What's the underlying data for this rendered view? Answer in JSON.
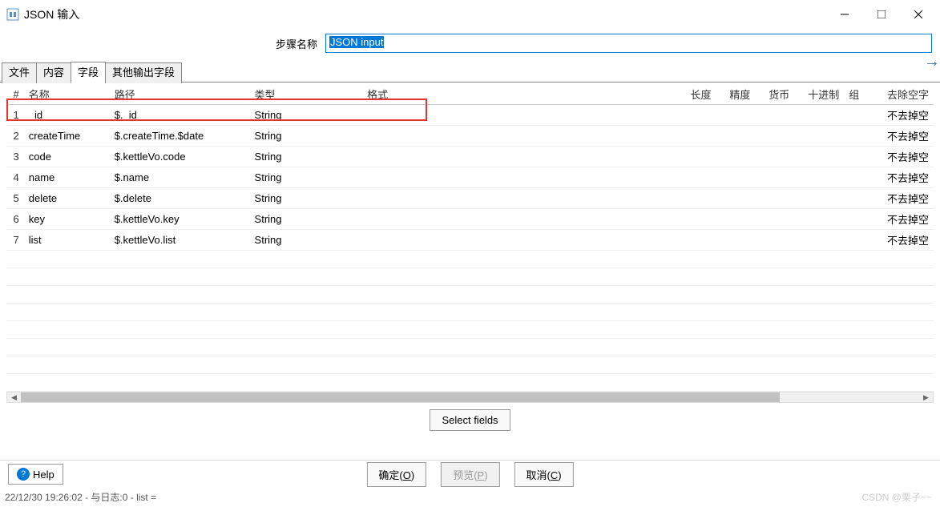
{
  "window": {
    "title": "JSON 输入"
  },
  "step": {
    "label": "步骤名称",
    "value": "JSON input"
  },
  "tabs": {
    "t0": "文件",
    "t1": "内容",
    "t2": "字段",
    "t3": "其他输出字段"
  },
  "columns": {
    "idx": "#",
    "name": "名称",
    "path": "路径",
    "type": "类型",
    "format": "格式",
    "length": "长度",
    "precision": "精度",
    "currency": "货币",
    "decimal": "十进制",
    "group": "组",
    "trim": "去除空字"
  },
  "rows": [
    {
      "idx": "1",
      "name": "_id",
      "path": "$._id",
      "type": "String",
      "format": "",
      "length": "",
      "precision": "",
      "currency": "",
      "decimal": "",
      "group": "",
      "trim": "不去掉空"
    },
    {
      "idx": "2",
      "name": "createTime",
      "path": "$.createTime.$date",
      "type": "String",
      "format": "",
      "length": "",
      "precision": "",
      "currency": "",
      "decimal": "",
      "group": "",
      "trim": "不去掉空"
    },
    {
      "idx": "3",
      "name": "code",
      "path": "$.kettleVo.code",
      "type": "String",
      "format": "",
      "length": "",
      "precision": "",
      "currency": "",
      "decimal": "",
      "group": "",
      "trim": "不去掉空"
    },
    {
      "idx": "4",
      "name": "name",
      "path": "$.name",
      "type": "String",
      "format": "",
      "length": "",
      "precision": "",
      "currency": "",
      "decimal": "",
      "group": "",
      "trim": "不去掉空"
    },
    {
      "idx": "5",
      "name": "delete",
      "path": "$.delete",
      "type": "String",
      "format": "",
      "length": "",
      "precision": "",
      "currency": "",
      "decimal": "",
      "group": "",
      "trim": "不去掉空"
    },
    {
      "idx": "6",
      "name": "key",
      "path": "$.kettleVo.key",
      "type": "String",
      "format": "",
      "length": "",
      "precision": "",
      "currency": "",
      "decimal": "",
      "group": "",
      "trim": "不去掉空"
    },
    {
      "idx": "7",
      "name": "list",
      "path": "$.kettleVo.list",
      "type": "String",
      "format": "",
      "length": "",
      "precision": "",
      "currency": "",
      "decimal": "",
      "group": "",
      "trim": "不去掉空"
    }
  ],
  "buttons": {
    "select_fields": "Select fields",
    "ok": "确定(O)",
    "preview": "预览(P)",
    "cancel": "取消(C)",
    "help": "Help"
  },
  "status": "22/12/30 19:26:02 - 与日志:0 - list =",
  "watermark": "CSDN @栗子~~"
}
